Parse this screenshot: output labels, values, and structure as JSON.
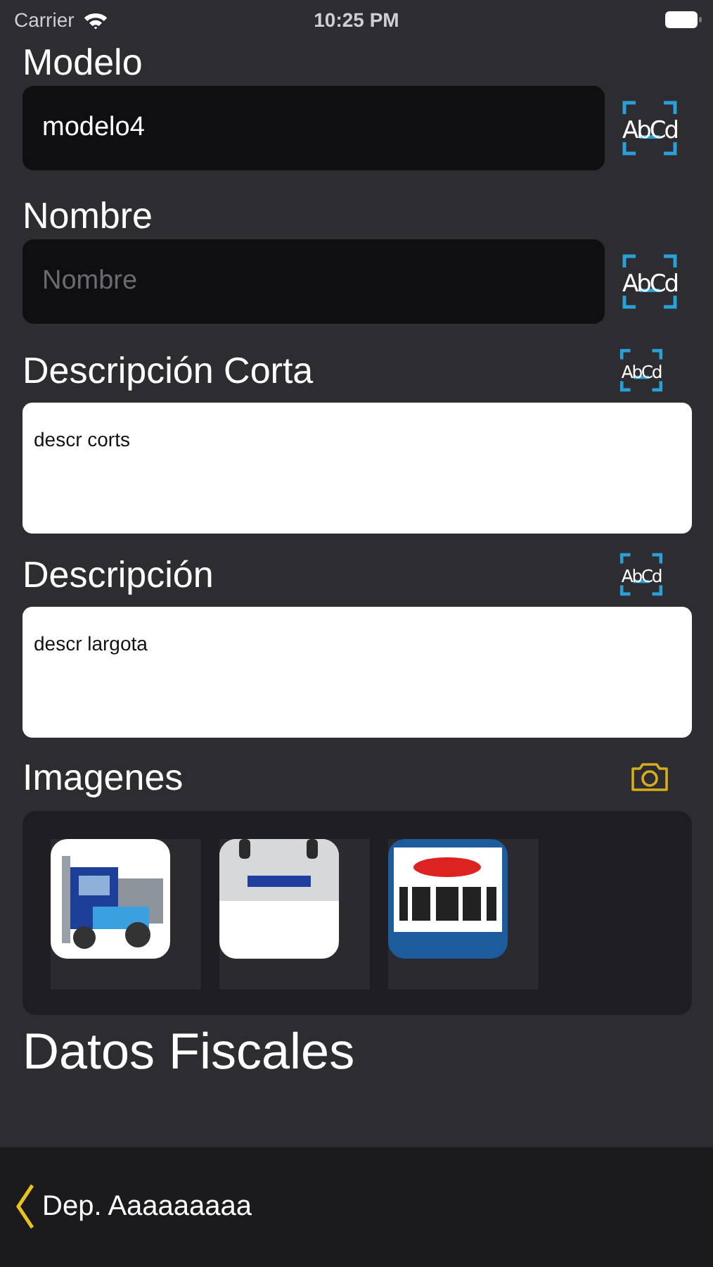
{
  "status_bar": {
    "carrier": "Carrier",
    "time": "10:25 PM"
  },
  "fields": [
    {
      "kind": "input",
      "label": "Modelo",
      "value": "modelo4",
      "scan_label": "AbCd"
    },
    {
      "kind": "input",
      "label": "Nombre",
      "placeholder": "Nombre",
      "scan_label": "AbCd"
    },
    {
      "kind": "textarea",
      "label": "Descripción Corta",
      "value": "descr corts",
      "scan_label": "AbCd"
    },
    {
      "kind": "textarea",
      "label": "Descripción",
      "value": "descr largota",
      "scan_label": "AbCd"
    }
  ],
  "images": {
    "title": "Imagenes"
  },
  "section_title": "Datos Fiscales",
  "back_button": {
    "label": "Dep. Aaaaaaaaa"
  }
}
